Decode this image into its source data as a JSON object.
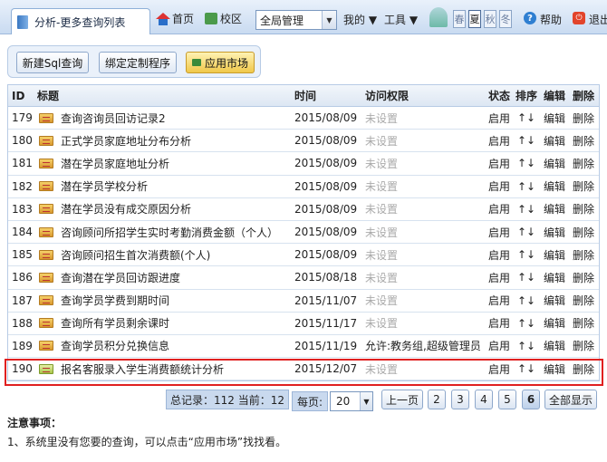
{
  "topbar": {
    "tab_title": "分析-更多查询列表",
    "home": "首页",
    "campus": "校区",
    "scope": "全局管理",
    "my": "我的 ▼",
    "tools": "工具 ▼",
    "seasons": [
      "春",
      "夏",
      "秋",
      "冬"
    ],
    "help": "帮助",
    "exit": "退出"
  },
  "toolbar": {
    "new_sql": "新建Sql查询",
    "bind_program": "绑定定制程序",
    "app_market": "应用市场"
  },
  "table": {
    "headers": {
      "id": "ID",
      "title": "标题",
      "time": "时间",
      "access": "访问权限",
      "status": "状态",
      "order": "排序",
      "edit": "编辑",
      "delete": "删除"
    },
    "rows": [
      {
        "id": "179",
        "title": "查询咨询员回访记录2",
        "time": "2015/08/09",
        "access": "未设置",
        "status": "启用",
        "order": "↑↓",
        "edit": "编辑",
        "delete": "删除"
      },
      {
        "id": "180",
        "title": "正式学员家庭地址分布分析",
        "time": "2015/08/09",
        "access": "未设置",
        "status": "启用",
        "order": "↑↓",
        "edit": "编辑",
        "delete": "删除"
      },
      {
        "id": "181",
        "title": "潜在学员家庭地址分析",
        "time": "2015/08/09",
        "access": "未设置",
        "status": "启用",
        "order": "↑↓",
        "edit": "编辑",
        "delete": "删除"
      },
      {
        "id": "182",
        "title": "潜在学员学校分析",
        "time": "2015/08/09",
        "access": "未设置",
        "status": "启用",
        "order": "↑↓",
        "edit": "编辑",
        "delete": "删除"
      },
      {
        "id": "183",
        "title": "潜在学员没有成交原因分析",
        "time": "2015/08/09",
        "access": "未设置",
        "status": "启用",
        "order": "↑↓",
        "edit": "编辑",
        "delete": "删除"
      },
      {
        "id": "184",
        "title": "咨询顾问所招学生实时考勤消费金额（个人）",
        "time": "2015/08/09",
        "access": "未设置",
        "status": "启用",
        "order": "↑↓",
        "edit": "编辑",
        "delete": "删除"
      },
      {
        "id": "185",
        "title": "咨询顾问招生首次消费额(个人)",
        "time": "2015/08/09",
        "access": "未设置",
        "status": "启用",
        "order": "↑↓",
        "edit": "编辑",
        "delete": "删除"
      },
      {
        "id": "186",
        "title": "查询潜在学员回访跟进度",
        "time": "2015/08/18",
        "access": "未设置",
        "status": "启用",
        "order": "↑↓",
        "edit": "编辑",
        "delete": "删除"
      },
      {
        "id": "187",
        "title": "查询学员学费到期时间",
        "time": "2015/11/07",
        "access": "未设置",
        "status": "启用",
        "order": "↑↓",
        "edit": "编辑",
        "delete": "删除"
      },
      {
        "id": "188",
        "title": "查询所有学员剩余课时",
        "time": "2015/11/17",
        "access": "未设置",
        "status": "启用",
        "order": "↑↓",
        "edit": "编辑",
        "delete": "删除"
      },
      {
        "id": "189",
        "title": "查询学员积分兑换信息",
        "time": "2015/11/19",
        "access": "允许:教务组,超级管理员",
        "status": "启用",
        "order": "↑↓",
        "edit": "编辑",
        "delete": "删除"
      },
      {
        "id": "190",
        "title": "报名客服录入学生消费额统计分析",
        "time": "2015/12/07",
        "access": "未设置",
        "status": "启用",
        "order": "↑↓",
        "edit": "编辑",
        "delete": "删除"
      }
    ]
  },
  "pager": {
    "summary": "总记录：112 当前：12",
    "page_size_label": "每页:",
    "page_size": "20",
    "prev": "上一页",
    "pages": [
      "2",
      "3",
      "4",
      "5",
      "6"
    ],
    "current": "6",
    "show_all": "全部显示"
  },
  "notes": {
    "title": "注意事项：",
    "line1": "1、系统里没有您要的查询，可以点击“应用市场”找找看。"
  }
}
